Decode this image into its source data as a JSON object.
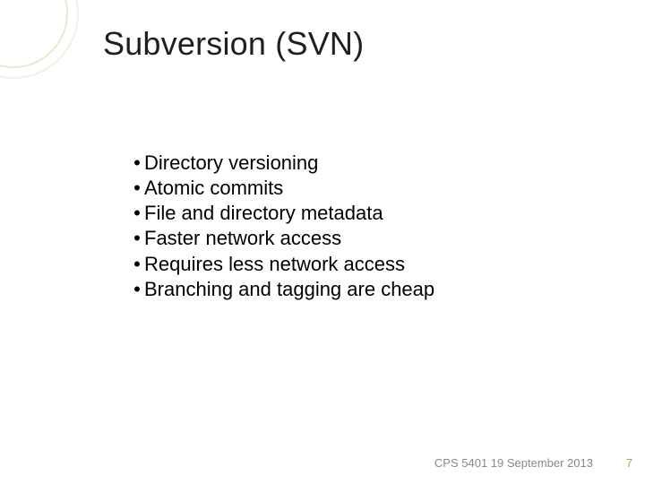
{
  "title": "Subversion (SVN)",
  "bullets": [
    "Directory versioning",
    "Atomic commits",
    "File and directory metadata",
    "Faster network access",
    "Requires less network access",
    "Branching and tagging are cheap"
  ],
  "footer_text": "CPS 5401  19 September 2013",
  "page_number": "7"
}
